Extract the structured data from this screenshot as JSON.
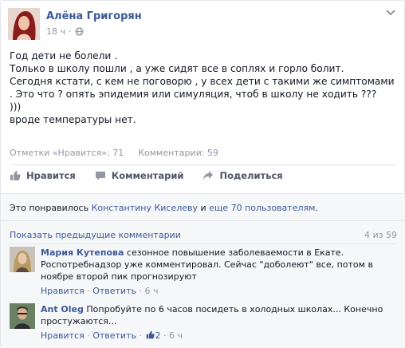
{
  "post": {
    "author": "Алёна Григорян",
    "time": "18 ч",
    "separator": "·",
    "lines": [
      "Год дети не болели .",
      "Только в школу пошли , а уже сидят все в соплях и горло болит.",
      "Сегодня кстати, с кем не поговорю , у всех дети с такими же симптомами",
      ". Это что ? опять эпидемия или симуляция, чтоб в школу не ходить ???",
      ")))",
      "вроде температуры нет."
    ],
    "stats": {
      "likes_label": "Отметки «Нравится»: 71",
      "comments_label": "Комментарии: 59"
    }
  },
  "actions": {
    "like": "Нравится",
    "comment": "Комментарий",
    "share": "Поделиться"
  },
  "likes_summary": {
    "prefix": "Это понравилось ",
    "person": "Константину Киселеву",
    "middle": " и ",
    "others": "еще 70 пользователям",
    "suffix": "."
  },
  "comments": {
    "show_previous": "Показать предыдущие комментарии",
    "count": "4 из 59",
    "items": [
      {
        "name": "Мария Кутепова",
        "line1": "сезонное повышение заболеваемости в Екате.",
        "line2": "Роспотребнадзор уже комментировал. Сейчас \"доболеют\" все, потом в",
        "line3": "ноябре второй пик прогнозируют",
        "like": "Нравится",
        "reply": "Ответить",
        "time": "6 ч",
        "likes": ""
      },
      {
        "name": "Ant Oleg",
        "line1": "Попробуйте по 6 часов посидеть в холодных школах... Конечно",
        "line2": "простужаются...",
        "line3": "",
        "like": "Нравится",
        "reply": "Ответить",
        "time": "6 ч",
        "likes": "2"
      }
    ]
  },
  "colors": {
    "link": "#3b5998",
    "muted": "#9197a3",
    "text": "#141823",
    "panel": "#f6f7f9"
  }
}
